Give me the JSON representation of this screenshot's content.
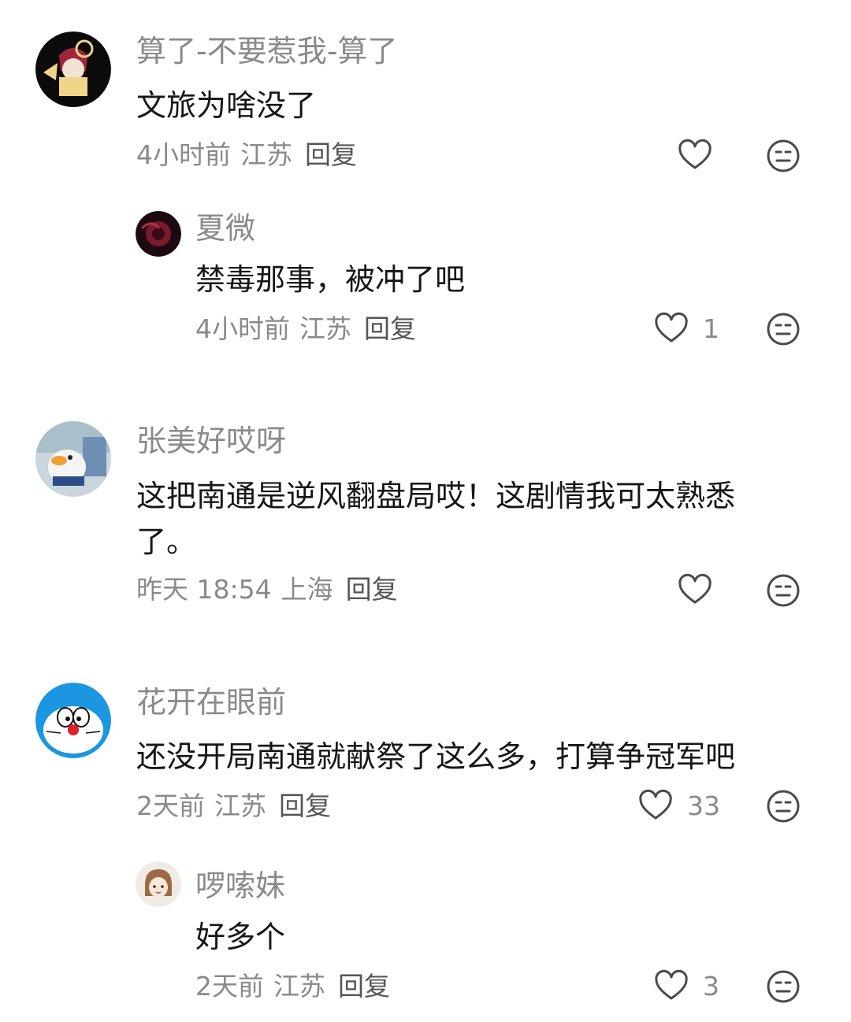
{
  "comments": [
    {
      "username": "算了-不要惹我-算了",
      "lines": [
        "文旅为啥没了"
      ],
      "time": "4小时前",
      "location": "江苏",
      "reply": "回复",
      "likes": "",
      "avatar_icon": "anime-avatar"
    },
    {
      "username": "夏微",
      "lines": [
        "禁毒那事，被冲了吧"
      ],
      "time": "4小时前",
      "location": "江苏",
      "reply": "回复",
      "likes": "1",
      "avatar_icon": "dark-red-avatar"
    },
    {
      "username": "张美好哎呀",
      "lines": [
        "这把南通是逆风翻盘局哎！这剧情我可太熟悉",
        "了。"
      ],
      "time": "昨天 18:54",
      "location": "上海",
      "reply": "回复",
      "likes": "",
      "avatar_icon": "duck-plush-avatar"
    },
    {
      "username": "花开在眼前",
      "lines": [
        "还没开局南通就献祭了这么多，打算争冠军吧"
      ],
      "time": "2天前",
      "location": "江苏",
      "reply": "回复",
      "likes": "33",
      "avatar_icon": "doraemon-avatar"
    },
    {
      "username": "啰嗦妹",
      "lines": [
        "好多个"
      ],
      "time": "2天前",
      "location": "江苏",
      "reply": "回复",
      "likes": "3",
      "avatar_icon": "cartoon-girl-avatar"
    }
  ],
  "colors": {
    "text_primary": "#161616",
    "text_secondary": "#8a8a8a",
    "icon": "#4a4a4a"
  }
}
